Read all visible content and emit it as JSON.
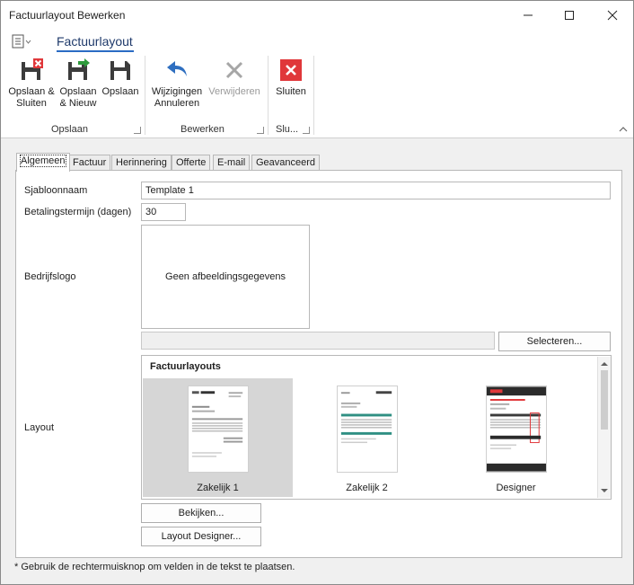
{
  "window": {
    "title": "Factuurlayout Bewerken"
  },
  "ribbon": {
    "tab": "Factuurlayout",
    "buttons": {
      "save_close": [
        "Opslaan &",
        "Sluiten"
      ],
      "save_new": [
        "Opslaan",
        "& Nieuw"
      ],
      "save": "Opslaan",
      "undo_changes": [
        "Wijzigingen",
        "Annuleren"
      ],
      "delete": "Verwijderen",
      "close": "Sluiten"
    },
    "groups": {
      "save": "Opslaan",
      "edit": "Bewerken",
      "close": "Slu..."
    }
  },
  "tabs": [
    "Algemeen",
    "Factuur",
    "Herinnering",
    "Offerte",
    "E-mail",
    "Geavanceerd"
  ],
  "form": {
    "template_name_label": "Sjabloonnaam",
    "template_name_value": "Template 1",
    "payment_term_label": "Betalingstermijn (dagen)",
    "payment_term_value": "30",
    "logo_label": "Bedrijfslogo",
    "logo_placeholder": "Geen afbeeldingsgegevens",
    "select_button": "Selecteren...",
    "layout_label": "Layout",
    "layouts_header": "Factuurlayouts",
    "layouts": [
      "Zakelijk 1",
      "Zakelijk 2",
      "Designer"
    ],
    "view_button": "Bekijken...",
    "designer_button": "Layout Designer..."
  },
  "footer_note": "* Gebruik de rechtermuisknop om velden in de tekst te plaatsen.",
  "colors": {
    "accent": "#2b6cc4",
    "close_red": "#e0373a",
    "green_arrow": "#2e9a3c",
    "teal": "#2f8f83"
  }
}
